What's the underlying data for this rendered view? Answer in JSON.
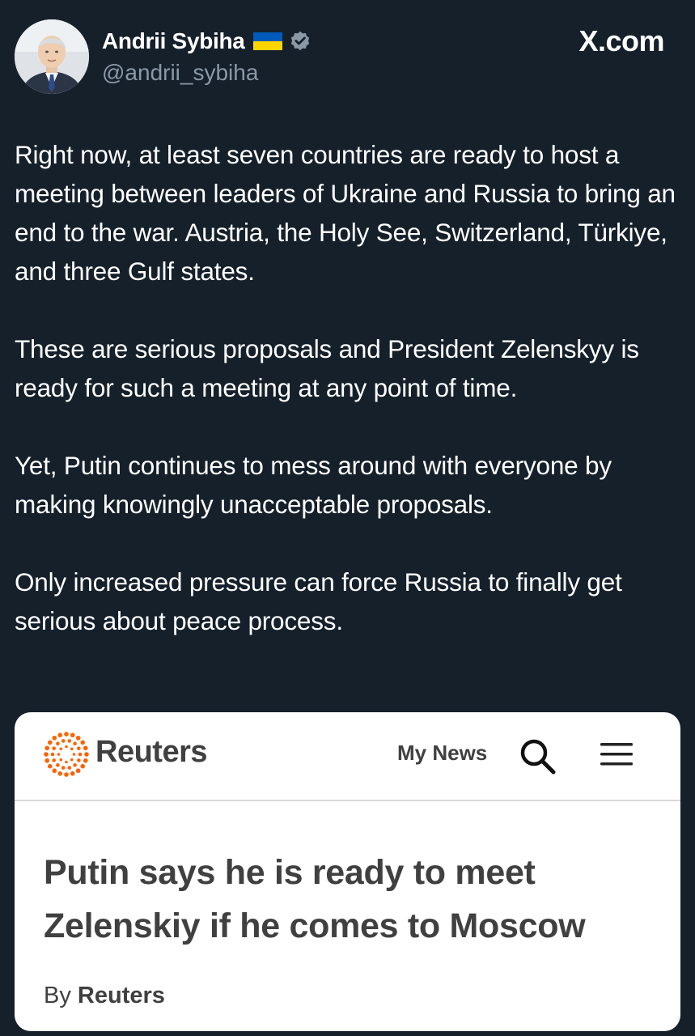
{
  "author": {
    "name": "Andrii Sybiha",
    "handle": "@andrii_sybiha",
    "flag_icon": "ukraine-flag-icon",
    "verified_icon": "verified-badge-icon"
  },
  "brand": "X.com",
  "tweet": {
    "paragraphs": [
      "Right now, at least seven countries are ready to host a meeting between leaders of Ukraine and Russia to bring an end to the war. Austria, the Holy See, Switzerland, Türkiye, and three Gulf states.",
      "These are serious proposals and President Zelenskyy is ready for such a meeting at any point of time.",
      "Yet, Putin continues to mess around with everyone by making knowingly unacceptable proposals.",
      "Only increased pressure can force Russia to finally get serious about peace process."
    ]
  },
  "card": {
    "site_name": "Reuters",
    "nav_link": "My News",
    "search_icon": "search-icon",
    "menu_icon": "hamburger-menu-icon",
    "headline": "Putin says he is ready to meet Zelenskiy if he comes to Moscow",
    "byline_prefix": "By",
    "byline_author": "Reuters"
  },
  "colors": {
    "background": "#15202b",
    "text": "#ffffff",
    "handle": "#8b98a5",
    "card_bg": "#ffffff",
    "card_text": "#404040",
    "reuters_orange": "#fa6400",
    "flag_blue": "#005bbb",
    "flag_yellow": "#ffd500"
  }
}
